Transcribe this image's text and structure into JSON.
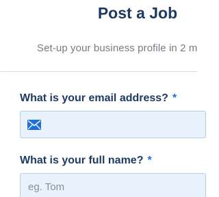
{
  "header": {
    "title": "Post a Job",
    "subtitle": "Set-up your business profile in 2 m"
  },
  "form": {
    "email": {
      "label": "What is your email address?",
      "required_mark": "*",
      "value": "",
      "placeholder": "",
      "icon": "envelope-icon"
    },
    "full_name": {
      "label": "What is your full name?",
      "required_mark": "*",
      "value": "",
      "placeholder": "eg. Tom"
    }
  },
  "colors": {
    "heading": "#1e3a63",
    "accent": "#1f6fd6",
    "input_background": "#e8f2fd",
    "muted_text": "#777b82"
  }
}
